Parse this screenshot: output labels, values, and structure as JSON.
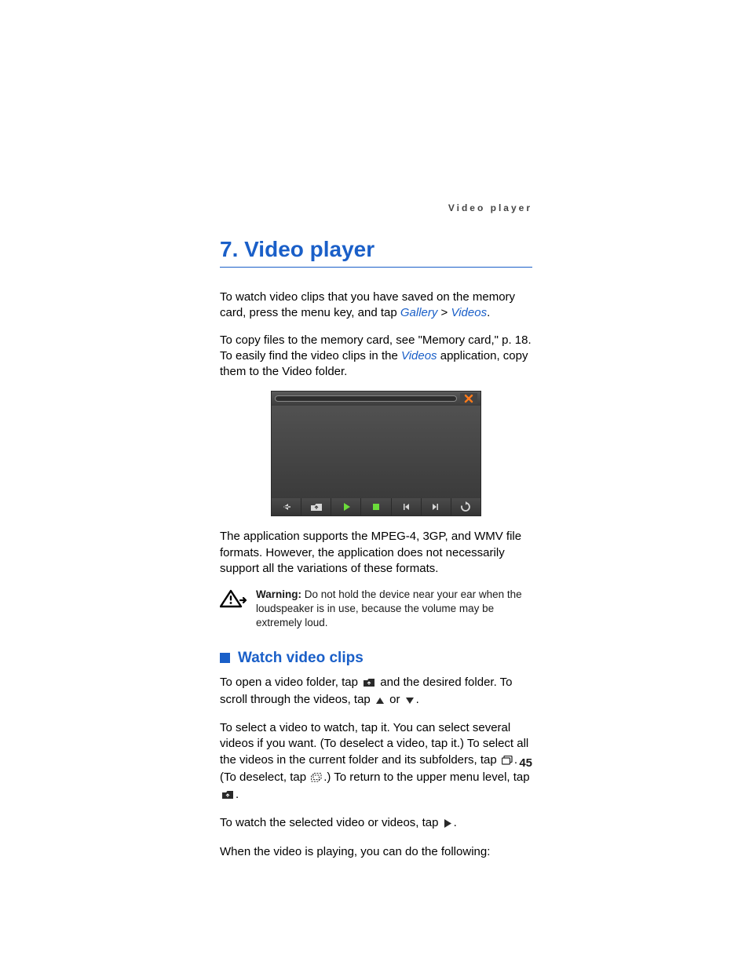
{
  "running_header": "Video player",
  "chapter": {
    "number": "7.",
    "title": "Video player"
  },
  "para1": {
    "pre": "To watch video clips that you have saved on the memory card, press the menu key, and tap ",
    "link1": "Gallery",
    "sep": " > ",
    "link2": "Videos",
    "post": "."
  },
  "para2": {
    "pre": "To copy files to the memory card, see \"Memory card,\" p. 18. To easily find the video clips in the ",
    "link": "Videos",
    "post": " application, copy them to the Video folder."
  },
  "para3": "The application supports the MPEG-4, 3GP, and WMV file formats. However, the application does not necessarily support all the variations of these formats.",
  "warning": {
    "label": "Warning:",
    "text": " Do not hold the device near your ear when the loudspeaker is in use, because the volume may be extremely loud."
  },
  "section_title": "Watch video clips",
  "para4": {
    "a": "To open a video folder, tap ",
    "b": " and the desired folder. To scroll through the videos, tap ",
    "c": " or ",
    "d": "."
  },
  "para5": {
    "a": "To select a video to watch, tap it. You can select several videos if you want. (To deselect a video, tap it.) To select all the videos in the current folder and its subfolders, tap ",
    "b": ". (To deselect, tap ",
    "c": ".) To return to the upper menu level, tap ",
    "d": "."
  },
  "para6": {
    "a": "To watch the selected video or videos, tap ",
    "b": "."
  },
  "para7": "When the video is playing, you can do the following:",
  "page_number": "45"
}
